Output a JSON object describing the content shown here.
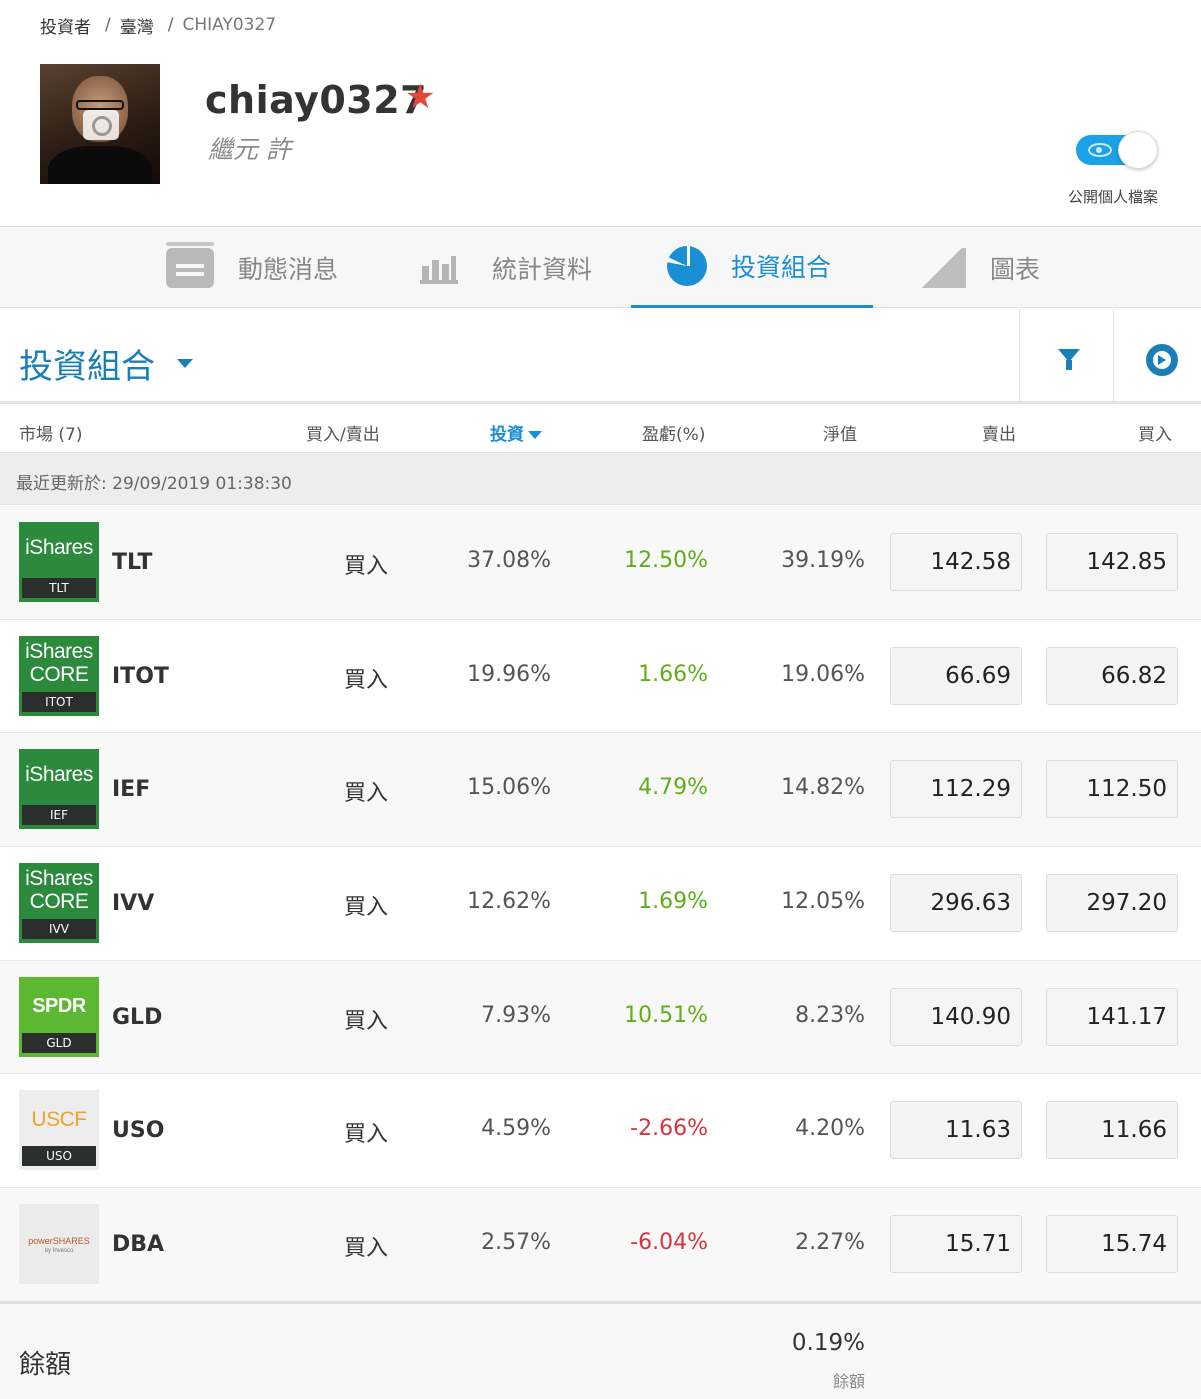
{
  "breadcrumb": {
    "items": [
      "投資者",
      "臺灣",
      "CHIAY0327"
    ],
    "separator": "/"
  },
  "profile": {
    "username": "chiay0327",
    "full_name": "繼元 許",
    "star_icon": "star-icon",
    "public_toggle_label": "公開個人檔案",
    "public_toggle_on": true
  },
  "tabs": [
    {
      "label": "動態消息",
      "icon": "news-feed-icon",
      "active": false
    },
    {
      "label": "統計資料",
      "icon": "bar-chart-icon",
      "active": false
    },
    {
      "label": "投資組合",
      "icon": "pie-chart-icon",
      "active": true
    },
    {
      "label": "圖表",
      "icon": "trend-chart-icon",
      "active": false
    }
  ],
  "section": {
    "title": "投資組合",
    "filter_icon": "filter-icon",
    "view_icon": "rotate-icon"
  },
  "columns": {
    "market": "市場 (7)",
    "action": "買入/賣出",
    "invested": "投資",
    "pl": "盈虧(%)",
    "value": "淨值",
    "sell": "賣出",
    "buy": "買入"
  },
  "last_updated": "最近更新於: 29/09/2019 01:38:30",
  "positions": [
    {
      "ticker": "TLT",
      "brand": "iShares",
      "brand2": "",
      "logo_style": "ishares",
      "action": "買入",
      "invested": "37.08%",
      "pl": "12.50%",
      "pl_sign": "pos",
      "value": "39.19%",
      "sell": "142.58",
      "buy": "142.85"
    },
    {
      "ticker": "ITOT",
      "brand": "iShares",
      "brand2": "CORE",
      "logo_style": "ishares",
      "action": "買入",
      "invested": "19.96%",
      "pl": "1.66%",
      "pl_sign": "pos",
      "value": "19.06%",
      "sell": "66.69",
      "buy": "66.82"
    },
    {
      "ticker": "IEF",
      "brand": "iShares",
      "brand2": "",
      "logo_style": "ishares",
      "action": "買入",
      "invested": "15.06%",
      "pl": "4.79%",
      "pl_sign": "pos",
      "value": "14.82%",
      "sell": "112.29",
      "buy": "112.50"
    },
    {
      "ticker": "IVV",
      "brand": "iShares",
      "brand2": "CORE",
      "logo_style": "ishares",
      "action": "買入",
      "invested": "12.62%",
      "pl": "1.69%",
      "pl_sign": "pos",
      "value": "12.05%",
      "sell": "296.63",
      "buy": "297.20"
    },
    {
      "ticker": "GLD",
      "brand": "SPDR",
      "brand2": "",
      "logo_style": "spdr",
      "action": "買入",
      "invested": "7.93%",
      "pl": "10.51%",
      "pl_sign": "pos",
      "value": "8.23%",
      "sell": "140.90",
      "buy": "141.17"
    },
    {
      "ticker": "USO",
      "brand": "USCF",
      "brand2": "",
      "logo_style": "uscf",
      "action": "買入",
      "invested": "4.59%",
      "pl": "-2.66%",
      "pl_sign": "neg",
      "value": "4.20%",
      "sell": "11.63",
      "buy": "11.66"
    },
    {
      "ticker": "DBA",
      "brand": "powerSHARES",
      "brand2": "by Invesco",
      "logo_style": "invesco",
      "action": "買入",
      "invested": "2.57%",
      "pl": "-6.04%",
      "pl_sign": "neg",
      "value": "2.27%",
      "sell": "15.71",
      "buy": "15.74"
    }
  ],
  "footer": {
    "label": "餘額",
    "value": "0.19%",
    "sub_label": "餘額"
  },
  "colors": {
    "accent": "#1a8fd6",
    "positive": "#5fae18",
    "negative": "#d9333f",
    "star": "#e4463a",
    "toggle": "#1aa2e8"
  }
}
